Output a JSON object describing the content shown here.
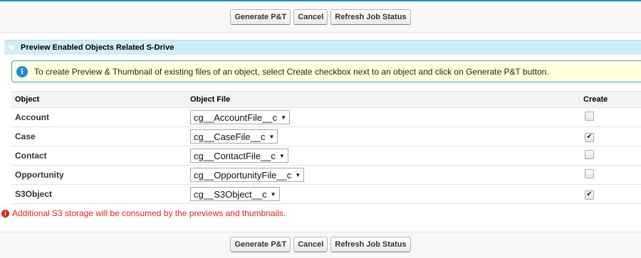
{
  "buttons": {
    "generate": "Generate P&T",
    "cancel": "Cancel",
    "refresh": "Refresh Job Status"
  },
  "section": {
    "title": "Preview Enabled Objects Related S-Drive"
  },
  "info": {
    "icon": "info-icon",
    "text": "To create Preview & Thumbnail of existing files of an object, select Create checkbox next to an object and click on Generate P&T button."
  },
  "table": {
    "headers": [
      "Object",
      "Object File",
      "Create"
    ],
    "rows": [
      {
        "object": "Account",
        "file": "cg__AccountFile__c",
        "create": false
      },
      {
        "object": "Case",
        "file": "cg__CaseFile__c",
        "create": true
      },
      {
        "object": "Contact",
        "file": "cg__ContactFile__c",
        "create": false
      },
      {
        "object": "Opportunity",
        "file": "cg__OpportunityFile__c",
        "create": false
      },
      {
        "object": "S3Object",
        "file": "cg__S3Object__c",
        "create": true
      }
    ]
  },
  "warning": {
    "icon": "error-icon",
    "text": "Additional S3 storage will be consumed by the previews and thumbnails."
  },
  "colors": {
    "accent": "#1797c0",
    "section_bg": "#cfeef8",
    "info_bg": "#ffffdc",
    "warning": "#d8231d"
  }
}
